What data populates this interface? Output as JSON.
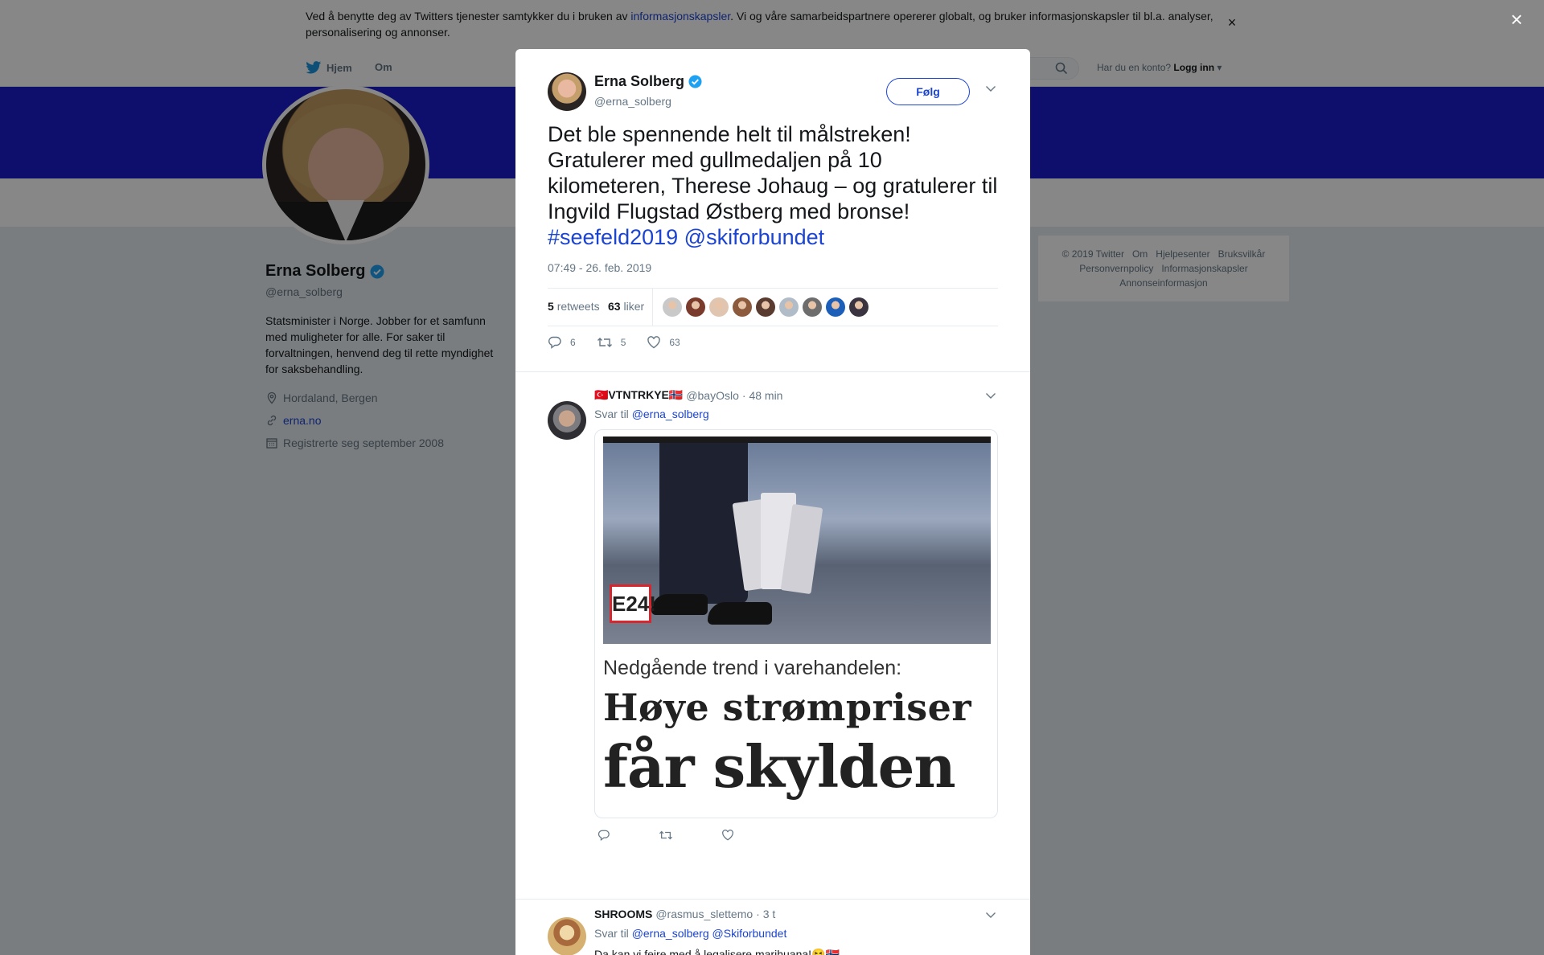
{
  "cookie_bar": {
    "text_before": "Ved å benytte deg av Twitters tjenester samtykker du i bruken av ",
    "link": "informasjonskapsler",
    "text_after": ". Vi og våre samarbeidspartnere opererer globalt, og bruker informasjonskapsler til bl.a. analyser, personalisering og annonser.",
    "close": "×"
  },
  "nav": {
    "home": "Hjem",
    "about": "Om",
    "account_prompt": "Har du en konto?",
    "login": "Logg inn"
  },
  "profile": {
    "name": "Erna Solberg",
    "handle": "@erna_solberg",
    "bio": "Statsminister i Norge. Jobber for et samfunn med muligheter for alle. For saker til forvaltningen, henvend deg til rette myndighet for saksbehandling.",
    "location": "Hordaland, Bergen",
    "website": "erna.no",
    "joined": "Registrerte seg september 2008"
  },
  "footer": {
    "links_row1": [
      "© 2019 Twitter",
      "Om",
      "Hjelpesenter",
      "Bruksvilkår"
    ],
    "links_row2": [
      "Personvernpolicy",
      "Informasjonskapsler"
    ],
    "links_row3": [
      "Annonseinformasjon"
    ]
  },
  "overlay": {
    "close": "×"
  },
  "tweet": {
    "name": "Erna Solberg",
    "handle": "@erna_solberg",
    "follow": "Følg",
    "text": "Det ble spennende helt til målstreken! Gratulerer med gullmedaljen på 10 kilometeren, Therese Johaug – og gratulerer til Ingvild Flugstad Østberg med bronse! ",
    "hashtag": "#seefeld2019",
    "mention": "@skiforbundet",
    "timestamp": "07:49 - 26. feb. 2019",
    "retweets_count": "5",
    "retweets_label": "retweets",
    "likes_count": "63",
    "likes_label": "liker",
    "liker_colors": [
      "#c9c9c9",
      "#7a3a2c",
      "#e0c5b0",
      "#8c5a3c",
      "#5a3b30",
      "#b0bcc8",
      "#6d6d6d",
      "#1d5fb8",
      "#3a3340"
    ],
    "actions": {
      "replies": "6",
      "retweets": "5",
      "likes": "63"
    }
  },
  "replies": [
    {
      "name": "🇹🇷VTNTRKYE🇳🇴",
      "handle": "@bayOslo",
      "time": "· 48 min",
      "reply_to_label": "Svar til",
      "reply_to": [
        "@erna_solberg"
      ],
      "media": {
        "subtitle": "Nedgående trend i varehandelen:",
        "headline1": "Høye strømpriser",
        "headline2": "får skylden",
        "logo": "E24!"
      }
    },
    {
      "name": "SHROOMS",
      "handle": "@rasmus_slettemo",
      "time": "· 3 t",
      "reply_to_label": "Svar til",
      "reply_to": [
        "@erna_solberg",
        "@Skiforbundet"
      ],
      "body": "Da kan vi feire med å legalisere marihuana!😆🇳🇴"
    }
  ]
}
